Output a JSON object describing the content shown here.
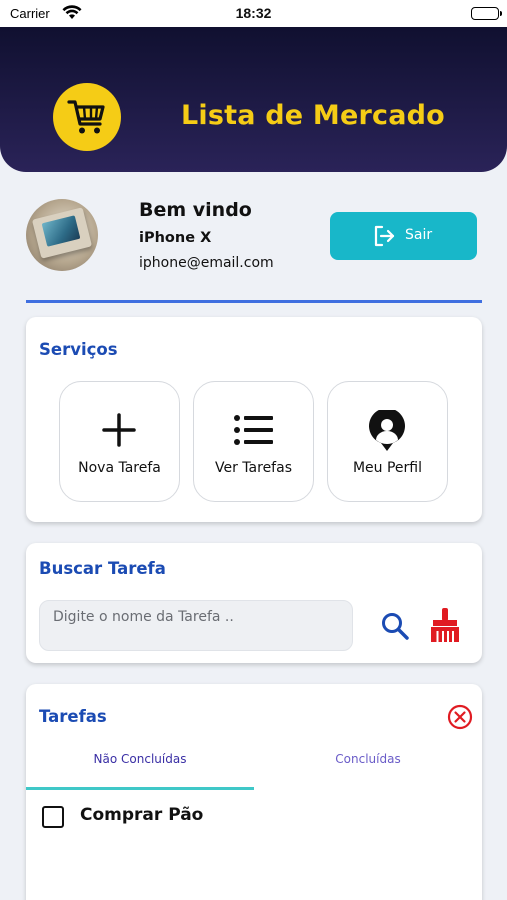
{
  "status_bar": {
    "carrier": "Carrier",
    "time": "18:32"
  },
  "header": {
    "title": "Lista de Mercado",
    "icon": "shopping-cart-icon",
    "accent_color": "#f5cc16",
    "bg_color": "#1a1840"
  },
  "profile": {
    "greeting": "Bem vindo",
    "name": "iPhone X",
    "email": "iphone@email.com",
    "logout_label": "Sair",
    "logout_color": "#18b7c9"
  },
  "services": {
    "title": "Serviços",
    "items": [
      {
        "label": "Nova Tarefa",
        "icon": "plus-icon"
      },
      {
        "label": "Ver Tarefas",
        "icon": "list-icon"
      },
      {
        "label": "Meu Perfil",
        "icon": "user-pin-icon"
      }
    ]
  },
  "search": {
    "title": "Buscar Tarefa",
    "placeholder": "Digite o nome da Tarefa ..",
    "value": ""
  },
  "tasks": {
    "title": "Tarefas",
    "tabs": [
      {
        "label": "Não Concluídas",
        "active": true
      },
      {
        "label": "Concluídas",
        "active": false
      }
    ],
    "items": [
      {
        "label": "Comprar Pão",
        "done": false
      }
    ]
  }
}
